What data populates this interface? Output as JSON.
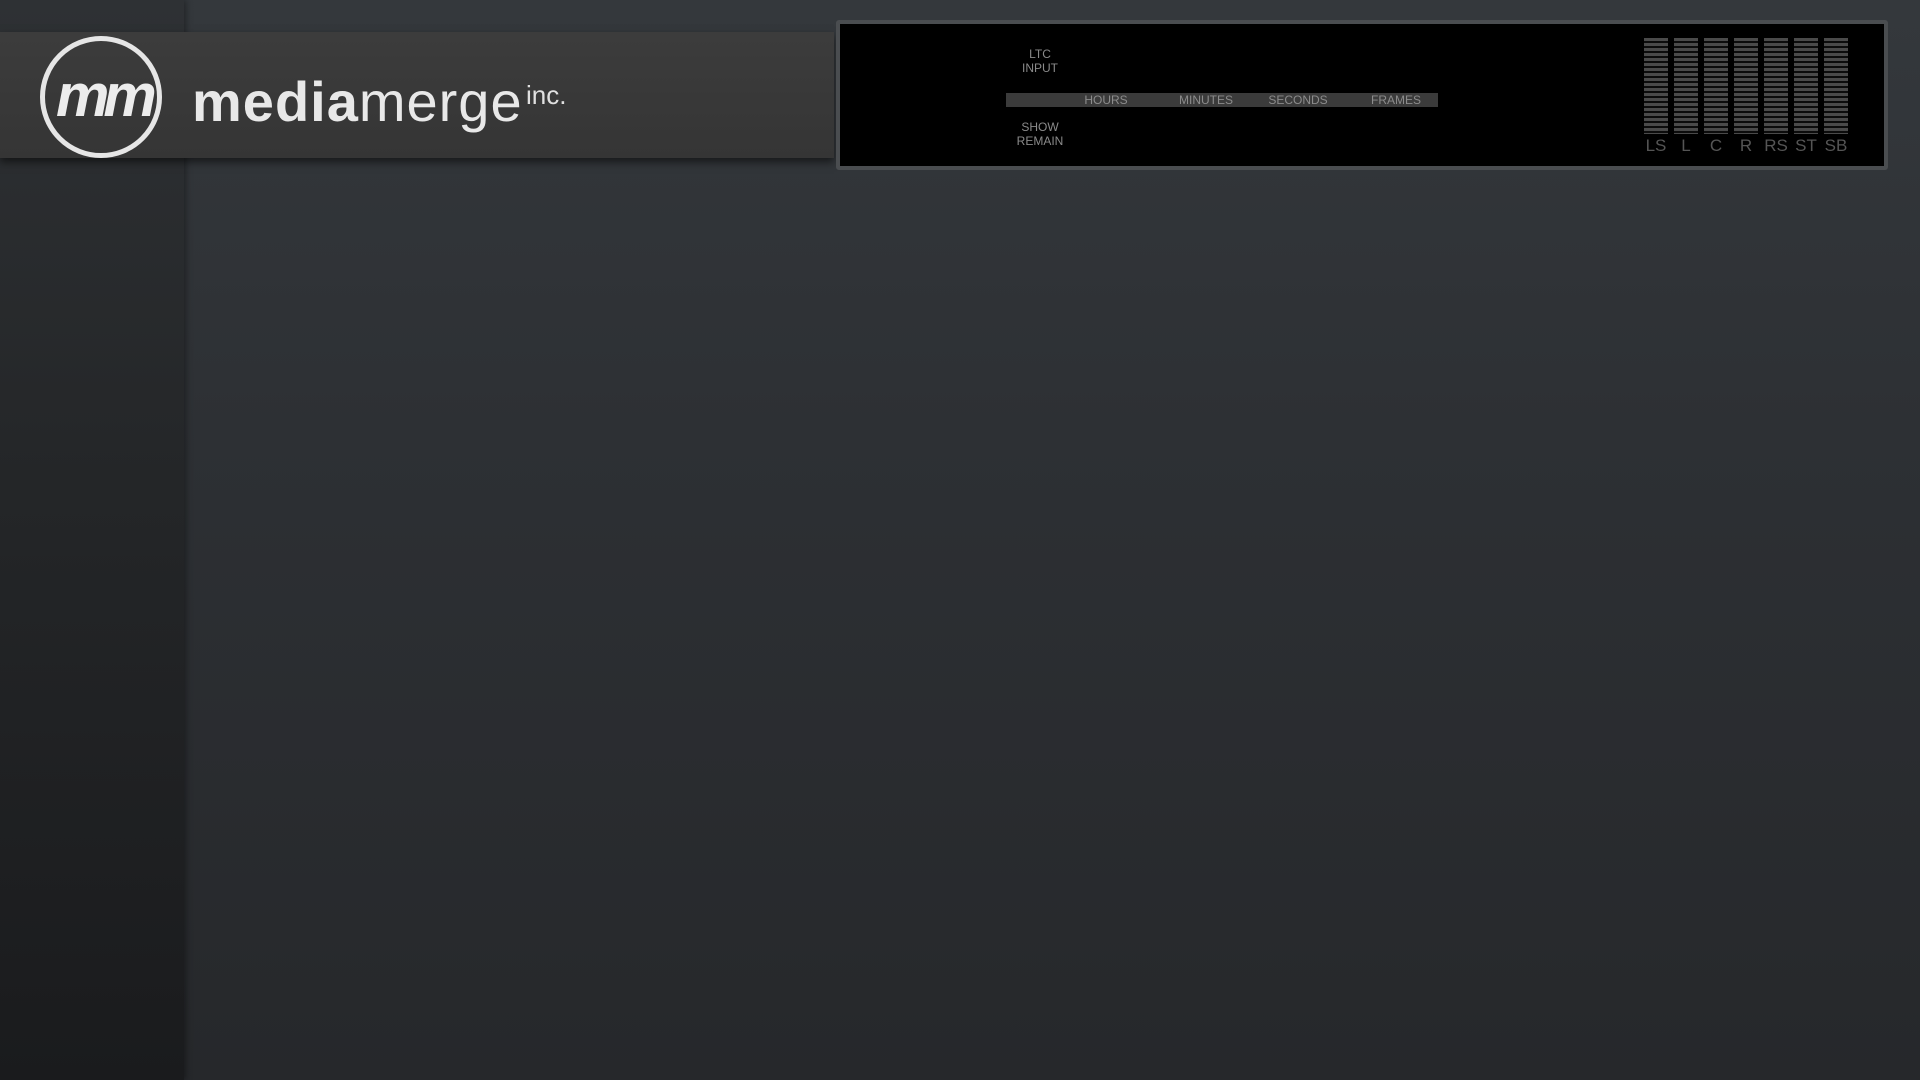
{
  "brand": {
    "mark": "mm",
    "word_bold": "media",
    "word_thin": "merge",
    "suffix": "inc."
  },
  "display": {
    "ltc_input": [
      "LTC",
      "INPUT"
    ],
    "show_remain": [
      "SHOW",
      "REMAIN"
    ],
    "timecode_headers": [
      "HOURS",
      "MINUTES",
      "SECONDS",
      "FRAMES"
    ],
    "meter_channels": [
      "LS",
      "L",
      "C",
      "R",
      "RS",
      "ST",
      "SB"
    ]
  },
  "colors": {
    "background": "#2d3034",
    "panel": "#000000",
    "logo": "#e8e8e8",
    "meter_segment": "#4a4a4a"
  }
}
